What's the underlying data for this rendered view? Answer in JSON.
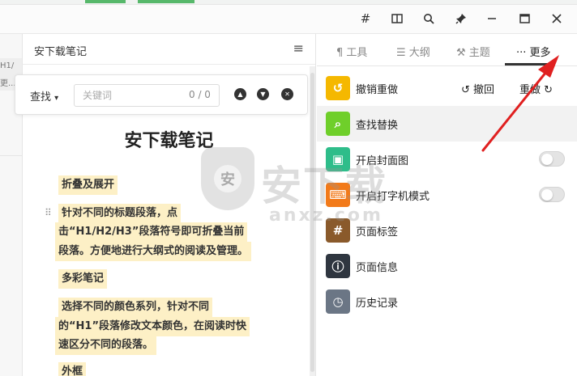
{
  "window": {
    "buttons": [
      {
        "name": "hash-icon",
        "glyph": "#"
      },
      {
        "name": "layout-icon",
        "glyph": "▯"
      },
      {
        "name": "search-icon",
        "glyph": "⚲"
      },
      {
        "name": "pin-icon",
        "glyph": "📌"
      },
      {
        "name": "minimize-icon",
        "glyph": "—"
      },
      {
        "name": "maximize-icon",
        "glyph": "▭"
      },
      {
        "name": "close-icon",
        "glyph": "✕"
      }
    ]
  },
  "left_rail": {
    "cut_text_1": "H1/",
    "cut_text_2": "更..."
  },
  "note": {
    "panel_title": "安下载笔记",
    "menu_glyph": "≡",
    "find": {
      "label": "查找",
      "caret": "▾",
      "placeholder": "关键词",
      "count": "0 / 0",
      "prev_glyph": "▲",
      "next_glyph": "▼",
      "clear_glyph": "✕"
    },
    "doc_title": "安下载笔记",
    "drag_handle": "⠿",
    "blocks": {
      "h_fold": "折叠及展开",
      "p_fold_1": "针对不同的标题段落，点",
      "p_fold_2": "击“H1/H2/H3”段落符号即可折叠当前",
      "p_fold_3": "段落。方便地进行大纲式的阅读及管理。",
      "h_color": "多彩笔记",
      "p_color_1": "选择不同的颜色系列，针对不同",
      "p_color_2": "的“H1”段落修改文本颜色，在阅读时快",
      "p_color_3": "速区分不同的段落。",
      "h_frame": "外框"
    }
  },
  "right_panel": {
    "tabs": [
      {
        "icon": "¶",
        "label": "工具"
      },
      {
        "icon": "☰",
        "label": "大纲"
      },
      {
        "icon": "⚒",
        "label": "主题"
      },
      {
        "icon": "···",
        "label": "更多"
      }
    ],
    "rows": {
      "undo": {
        "label": "撤销重做",
        "icon_glyph": "↺",
        "icon_color": "#f5b800",
        "undo_label": "↺ 撤回",
        "redo_label": "重做 ↻"
      },
      "find": {
        "label": "查找替换",
        "icon_glyph": "⌕",
        "icon_color": "#6fcf2a"
      },
      "cover": {
        "label": "开启封面图",
        "icon_glyph": "▣",
        "icon_color": "#2ebd8a"
      },
      "typewriter": {
        "label": "开启打字机模式",
        "icon_glyph": "⌨",
        "icon_color": "#f27a1a"
      },
      "tags": {
        "label": "页面标签",
        "icon_glyph": "#",
        "icon_color": "#8a5a2b"
      },
      "info": {
        "label": "页面信息",
        "icon_glyph": "ⓘ",
        "icon_color": "#2f3640"
      },
      "history": {
        "label": "历史记录",
        "icon_glyph": "◷",
        "icon_color": "#6b7685"
      }
    }
  },
  "watermark": {
    "shield_char": "安",
    "main": "安下载",
    "sub": "anxz.com"
  },
  "colors": {
    "annotation_arrow": "#e02020",
    "highlight": "#fdf0c6"
  }
}
